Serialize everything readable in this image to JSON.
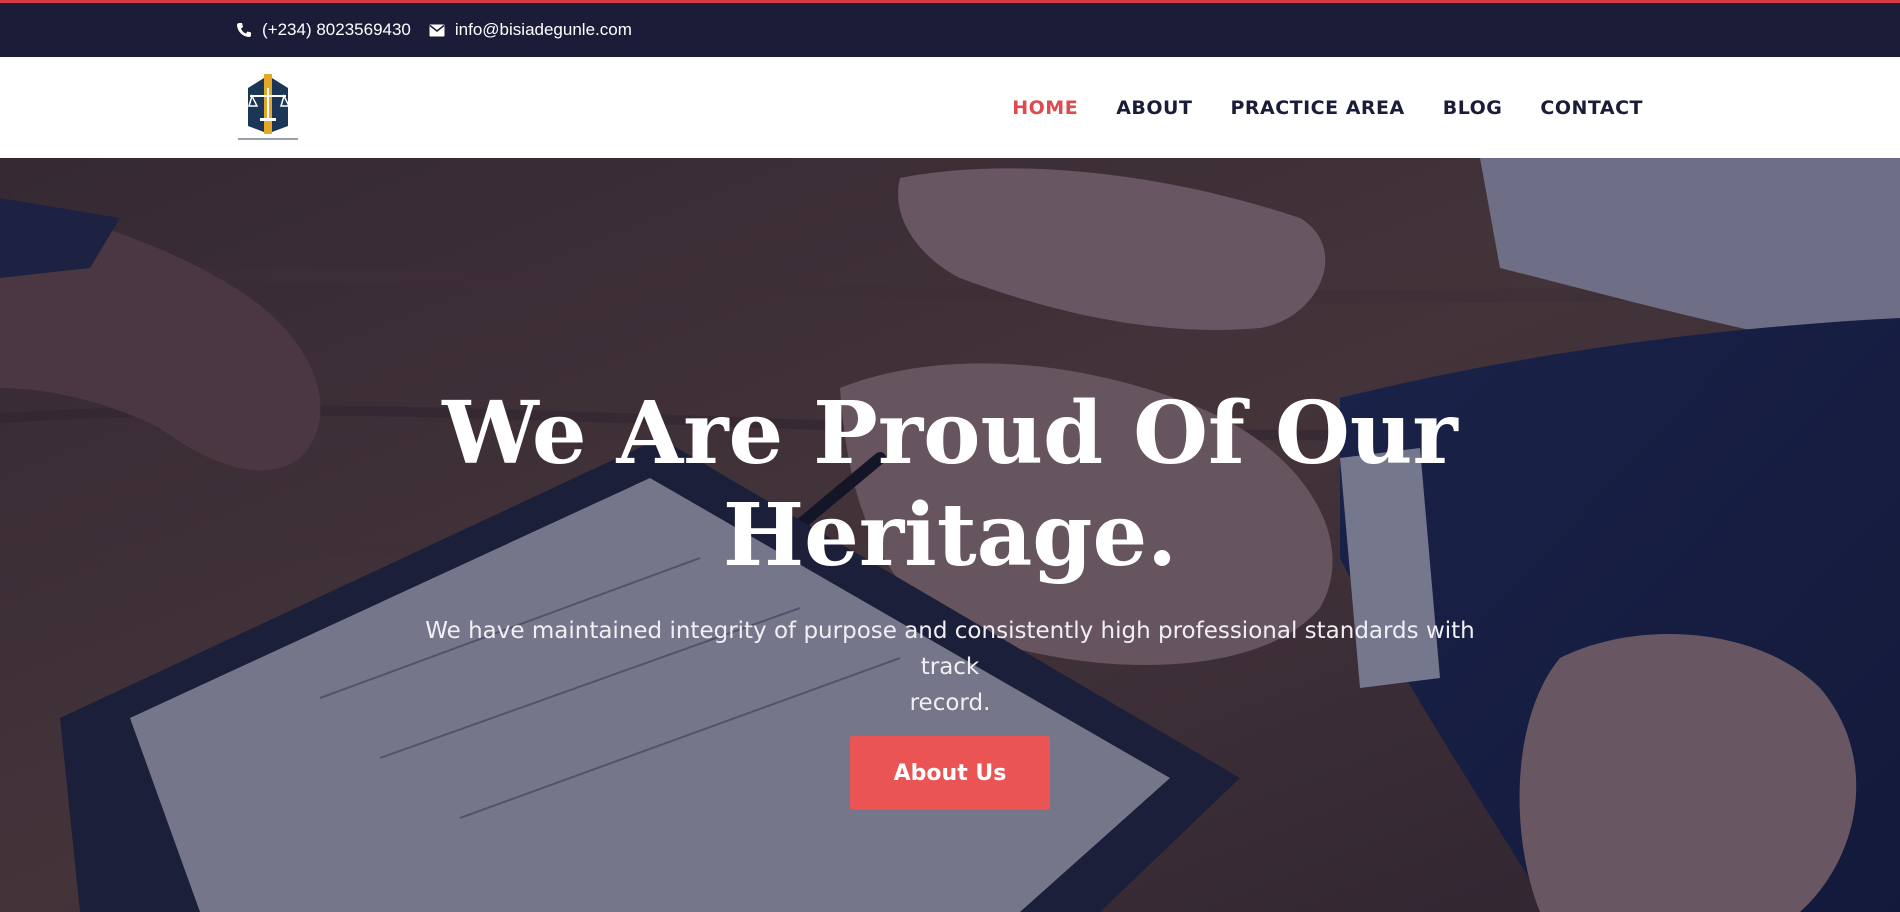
{
  "topbar": {
    "phone": "(+234) 8023569430",
    "email": "info@bisiadegunle.com",
    "phone_icon": "phone-icon",
    "email_icon": "envelope-icon"
  },
  "header": {
    "logo_alt": "Bisi Adegunle & Co",
    "nav": [
      {
        "label": "HOME",
        "active": true
      },
      {
        "label": "ABOUT",
        "active": false
      },
      {
        "label": "PRACTICE AREA",
        "active": false
      },
      {
        "label": "BLOG",
        "active": false
      },
      {
        "label": "CONTACT",
        "active": false
      }
    ]
  },
  "hero": {
    "title_line1": "We Are Proud Of Our",
    "title_line2": "Heritage.",
    "subtitle_line1": "We have maintained integrity of purpose and consistently high professional standards with track",
    "subtitle_line2": "record.",
    "button_label": "About Us"
  },
  "colors": {
    "topbar_bg": "#1b1c38",
    "accent": "#ea5455",
    "nav_text": "#1b1c38",
    "nav_active": "#e04a4f"
  }
}
